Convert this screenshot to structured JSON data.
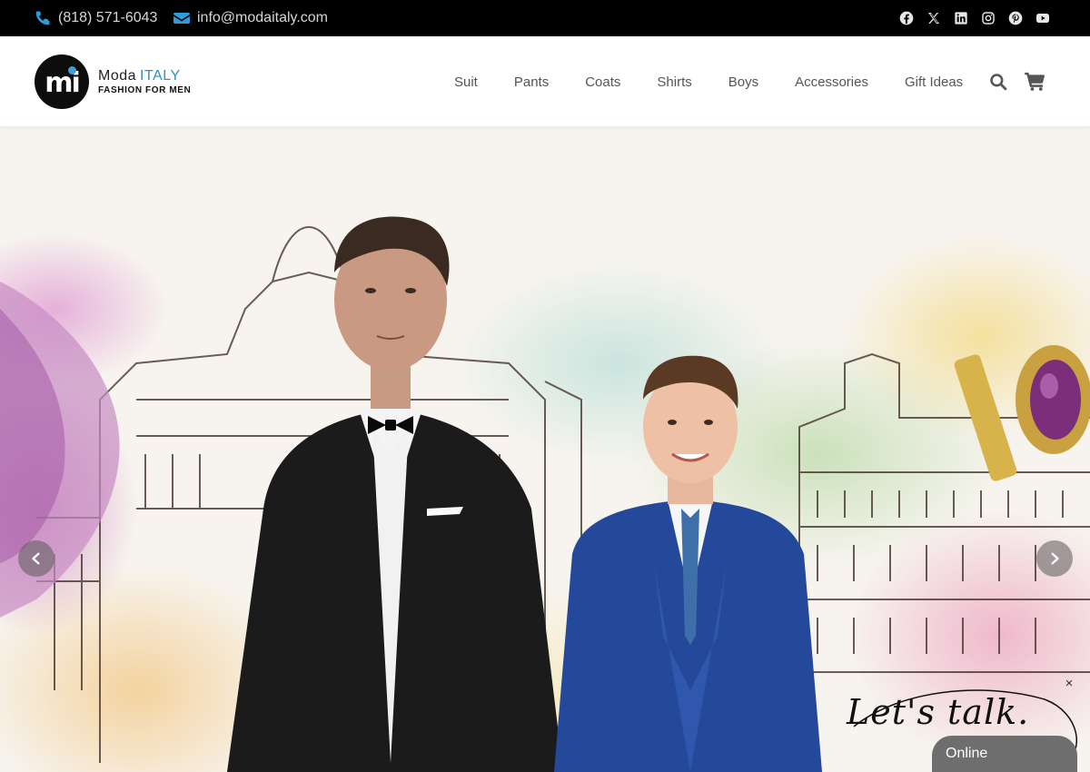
{
  "topbar": {
    "phone": "(818) 571-6043",
    "email": "info@modaitaly.com",
    "socials": [
      "facebook-icon",
      "x-icon",
      "linkedin-icon",
      "instagram-icon",
      "pinterest-icon",
      "youtube-icon"
    ]
  },
  "brand": {
    "mark": "mi",
    "name": "Moda",
    "name_accent": "ITALY",
    "tagline": "FASHION FOR MEN",
    "accent_color": "#2e8fcf"
  },
  "nav": {
    "items": [
      "Suit",
      "Pants",
      "Coats",
      "Shirts",
      "Boys",
      "Accessories",
      "Gift Ideas"
    ]
  },
  "header_icons": [
    "search-icon",
    "cart-icon"
  ],
  "hero": {
    "prev_icon": "chevron-left-icon",
    "next_icon": "chevron-right-icon"
  },
  "chat": {
    "script_text": "Let's talk.",
    "close_label": "×",
    "status": "Online"
  }
}
